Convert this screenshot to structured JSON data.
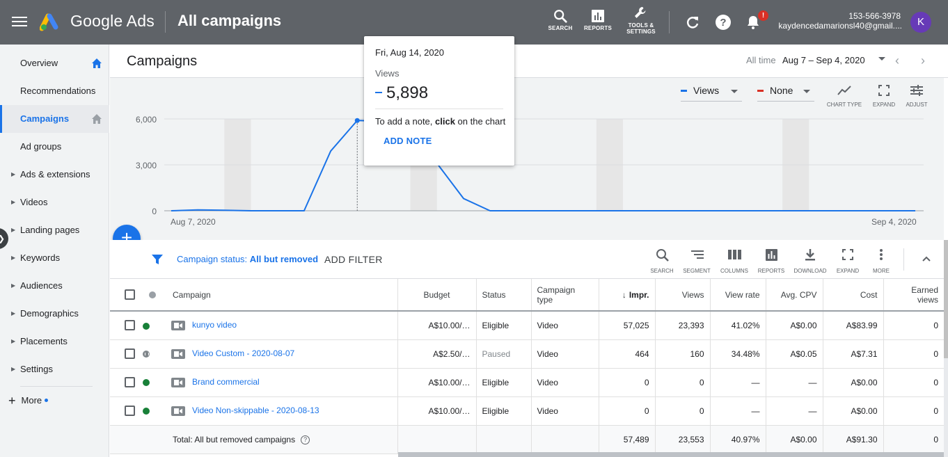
{
  "topbar": {
    "brand": "Google Ads",
    "page_heading": "All campaigns",
    "tools": [
      {
        "label": "SEARCH",
        "icon": "search-icon"
      },
      {
        "label": "REPORTS",
        "icon": "reports-icon"
      },
      {
        "label": "TOOLS &",
        "label2": "SETTINGS",
        "icon": "wrench-icon"
      }
    ],
    "notification_badge": "!",
    "account_phone": "153-566-3978",
    "account_email": "kaydencedamarionsl40@gmail....",
    "avatar_letter": "K"
  },
  "sidebar": {
    "items": [
      {
        "label": "Overview",
        "home": true
      },
      {
        "label": "Recommendations"
      },
      {
        "label": "Campaigns",
        "active": true,
        "home": true
      },
      {
        "label": "Ad groups"
      },
      {
        "label": "Ads & extensions",
        "caret": true
      },
      {
        "label": "Videos",
        "caret": true
      },
      {
        "label": "Landing pages",
        "caret": true
      },
      {
        "label": "Keywords",
        "caret": true
      },
      {
        "label": "Audiences",
        "caret": true
      },
      {
        "label": "Demographics",
        "caret": true
      },
      {
        "label": "Placements",
        "caret": true
      },
      {
        "label": "Settings",
        "caret": true
      }
    ],
    "more_label": "More"
  },
  "header": {
    "title": "Campaigns",
    "range_label": "All time",
    "range_value": "Aug 7 – Sep 4, 2020"
  },
  "chart_controls": {
    "metric1": "Views",
    "metric2": "None",
    "tools": [
      "CHART TYPE",
      "EXPAND",
      "ADJUST"
    ]
  },
  "chart_data": {
    "type": "line",
    "ylim": [
      0,
      6000
    ],
    "y_ticks": [
      "6,000",
      "3,000",
      "0"
    ],
    "x_start_label": "Aug 7, 2020",
    "x_end_label": "Sep 4, 2020",
    "series": [
      {
        "name": "Views",
        "color": "#1a73e8",
        "x": [
          "Aug 7",
          "Aug 8",
          "Aug 9",
          "Aug 10",
          "Aug 11",
          "Aug 12",
          "Aug 13",
          "Aug 14",
          "Aug 15",
          "Aug 16",
          "Aug 17",
          "Aug 18",
          "Aug 19",
          "Aug 20",
          "Aug 21",
          "Aug 22",
          "Aug 23",
          "Aug 24",
          "Aug 25",
          "Aug 26",
          "Aug 27",
          "Aug 28",
          "Aug 29",
          "Aug 30",
          "Aug 31",
          "Sep 1",
          "Sep 2",
          "Sep 3",
          "Sep 4"
        ],
        "values": [
          0,
          60,
          30,
          0,
          0,
          0,
          3900,
          5898,
          5850,
          5500,
          3100,
          800,
          0,
          0,
          0,
          0,
          0,
          0,
          0,
          0,
          0,
          0,
          0,
          0,
          0,
          0,
          0,
          0,
          0
        ]
      }
    ],
    "weekend_bands": [
      [
        2,
        3
      ],
      [
        9,
        10
      ],
      [
        16,
        17
      ],
      [
        23,
        24
      ]
    ]
  },
  "tooltip": {
    "date": "Fri, Aug 14, 2020",
    "metric": "Views",
    "value": "5,898",
    "note_prefix": "To add a note, ",
    "note_bold": "click",
    "note_suffix": " on the chart",
    "add_note": "ADD NOTE"
  },
  "filter_bar": {
    "status_prefix": "Campaign status: ",
    "status_value": "All but removed",
    "add_filter": "ADD FILTER",
    "tools": [
      "SEARCH",
      "SEGMENT",
      "COLUMNS",
      "REPORTS",
      "DOWNLOAD",
      "EXPAND",
      "MORE"
    ]
  },
  "table": {
    "headers": {
      "campaign": "Campaign",
      "budget": "Budget",
      "status": "Status",
      "type_1": "Campaign",
      "type_2": "type",
      "impr": "Impr.",
      "views": "Views",
      "view_rate": "View rate",
      "avg_cpv": "Avg. CPV",
      "cost": "Cost",
      "earned_1": "Earned",
      "earned_2": "views"
    },
    "rows": [
      {
        "campaign": "kunyo video",
        "budget": "A$10.00/…",
        "status": "Eligible",
        "type": "Video",
        "impr": "57,025",
        "views": "23,393",
        "view_rate": "41.02%",
        "avg_cpv": "A$0.00",
        "cost": "A$83.99",
        "earned": "0",
        "state": "enabled"
      },
      {
        "campaign": "Video Custom - 2020-08-07",
        "budget": "A$2.50/…",
        "status": "Paused",
        "type": "Video",
        "impr": "464",
        "views": "160",
        "view_rate": "34.48%",
        "avg_cpv": "A$0.05",
        "cost": "A$7.31",
        "earned": "0",
        "state": "paused"
      },
      {
        "campaign": "Brand commercial",
        "budget": "A$10.00/…",
        "status": "Eligible",
        "type": "Video",
        "impr": "0",
        "views": "0",
        "view_rate": "—",
        "avg_cpv": "—",
        "cost": "A$0.00",
        "earned": "0",
        "state": "enabled"
      },
      {
        "campaign": "Video Non-skippable - 2020-08-13",
        "budget": "A$10.00/…",
        "status": "Eligible",
        "type": "Video",
        "impr": "0",
        "views": "0",
        "view_rate": "—",
        "avg_cpv": "—",
        "cost": "A$0.00",
        "earned": "0",
        "state": "enabled"
      }
    ],
    "total": {
      "label": "Total: All but removed campaigns",
      "impr": "57,489",
      "views": "23,553",
      "view_rate": "40.97%",
      "avg_cpv": "A$0.00",
      "cost": "A$91.30",
      "earned": "0"
    }
  }
}
